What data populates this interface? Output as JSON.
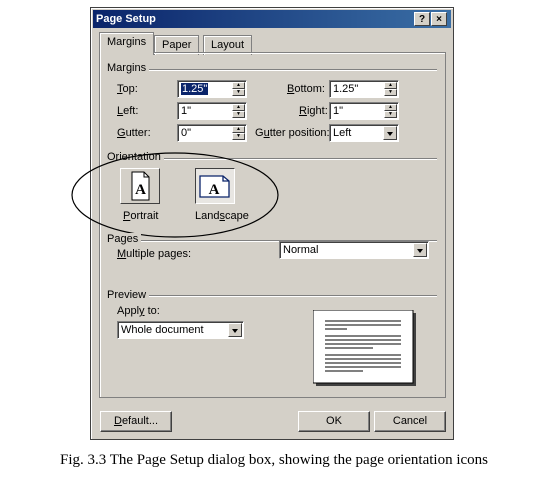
{
  "dialog": {
    "title": "Page Setup",
    "help_label": "?",
    "close_label": "×"
  },
  "tabs": [
    {
      "label": "Margins",
      "active": true
    },
    {
      "label": "Paper",
      "active": false
    },
    {
      "label": "Layout",
      "active": false
    }
  ],
  "margins": {
    "group_label": "Margins",
    "top": {
      "access": "T",
      "rest": "op:",
      "value": "1.25\""
    },
    "bottom": {
      "access": "B",
      "rest": "ottom:",
      "value": "1.25\""
    },
    "left": {
      "access": "L",
      "rest": "eft:",
      "value": "1\""
    },
    "right": {
      "access": "R",
      "rest": "ight:",
      "value": "1\""
    },
    "gutter": {
      "access": "G",
      "rest": "utter:",
      "value": "0\""
    },
    "gutter_position": {
      "pre": "G",
      "access": "u",
      "rest": "tter position:",
      "value": "Left"
    }
  },
  "orientation": {
    "group_label": "Orientation",
    "portrait": {
      "access": "P",
      "rest": "ortrait",
      "glyph": "A"
    },
    "landscape": {
      "pre": "Land",
      "access": "s",
      "rest": "cape",
      "glyph": "A"
    }
  },
  "pages": {
    "group_label": "Pages",
    "multiple_pages": {
      "access": "M",
      "rest": "ultiple pages:",
      "value": "Normal"
    }
  },
  "preview": {
    "group_label": "Preview",
    "apply_to": {
      "pre": "Appl",
      "access": "y",
      "rest": " to:",
      "value": "Whole document"
    }
  },
  "buttons": {
    "default": {
      "access": "D",
      "rest": "efault..."
    },
    "ok": "OK",
    "cancel": "Cancel"
  },
  "caption": "Fig. 3.3 The Page Setup dialog box, showing the page orientation icons",
  "colors": {
    "titlebar": "#0a246a",
    "dialog_bg": "#d4d0c8",
    "selection": "#0a246a"
  }
}
